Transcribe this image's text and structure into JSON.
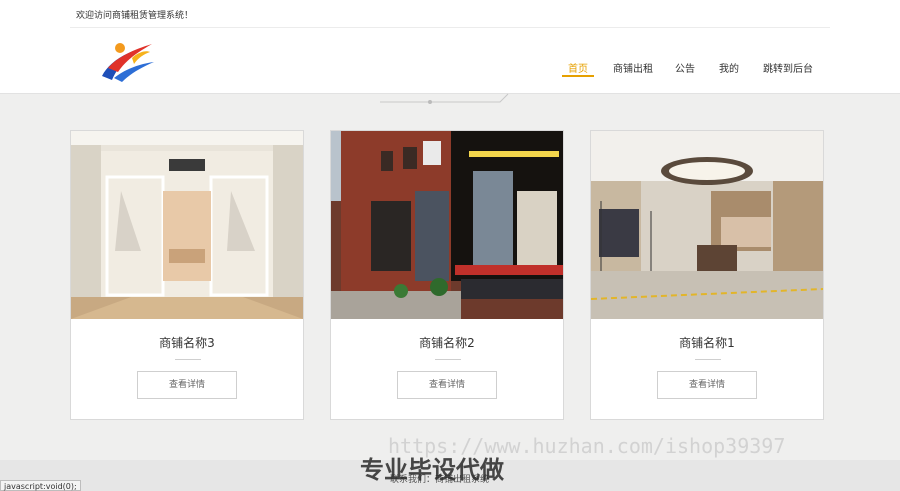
{
  "topbar": {
    "welcome": "欢迎访问商铺租赁管理系统！"
  },
  "nav": {
    "items": [
      {
        "label": "首页",
        "active": true
      },
      {
        "label": "商铺出租",
        "active": false
      },
      {
        "label": "公告",
        "active": false
      },
      {
        "label": "我的",
        "active": false
      },
      {
        "label": "跳转到后台",
        "active": false
      }
    ]
  },
  "cards": [
    {
      "name": "商铺名称3",
      "button": "查看详情"
    },
    {
      "name": "商铺名称2",
      "button": "查看详情"
    },
    {
      "name": "商铺名称1",
      "button": "查看详情"
    }
  ],
  "footer": {
    "text": "联系我们：商铺出租系统"
  },
  "overlay": {
    "watermark": "https://www.huzhan.com/ishop39397",
    "caption": "专业毕设代做"
  },
  "statusbar": {
    "text": "javascript:void(0);"
  },
  "colors": {
    "accent": "#e6a000",
    "background": "#efefee"
  }
}
